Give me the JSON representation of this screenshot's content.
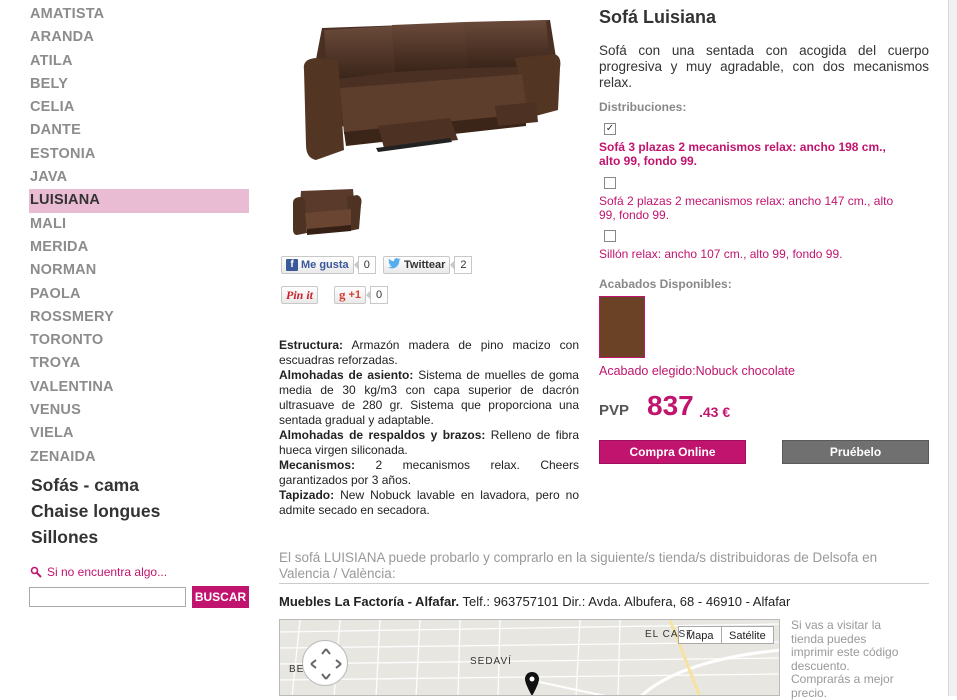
{
  "sidebar": {
    "models": [
      "AMATISTA",
      "ARANDA",
      "ATILA",
      "BELY",
      "CELIA",
      "DANTE",
      "ESTONIA",
      "JAVA",
      "LUISIANA",
      "MALI",
      "MERIDA",
      "NORMAN",
      "PAOLA",
      "ROSSMERY",
      "TORONTO",
      "TROYA",
      "VALENTINA",
      "VENUS",
      "VIELA",
      "ZENAIDA"
    ],
    "active_model": "LUISIANA",
    "categories": [
      "Sofás - cama",
      "Chaise longues",
      "Sillones"
    ],
    "search_hint": "Si no encuentra algo...",
    "search_value": "",
    "search_button": "BUSCAR"
  },
  "social": {
    "like_label": "Me gusta",
    "like_count": "0",
    "twitter_label": "Twittear",
    "twitter_count": "2",
    "pinit_label": "Pin it",
    "gplus_label": "+1",
    "gplus_count": "0"
  },
  "description": [
    {
      "label": "Estructura:",
      "text": " Armazón madera de pino macizo con escuadras reforzadas."
    },
    {
      "label": "Almohadas de asiento:",
      "text": " Sistema de muelles de goma media de 30 kg/m3 con capa superior de dacrón ultrasuave de 280 gr. Sistema que proporciona una sentada gradual y adaptable."
    },
    {
      "label": "Almohadas de respaldos y brazos:",
      "text": " Relleno de fibra hueca virgen siliconada."
    },
    {
      "label": "Mecanismos:",
      "text": " 2 mecanismos relax. Cheers garantizados por 3 años."
    },
    {
      "label": "Tapizado:",
      "text": " New Nobuck lavable en lavadora, pero no admite secado en secadora."
    }
  ],
  "product": {
    "title": "Sofá Luisiana",
    "intro": "Sofá con una sentada con acogida del cuerpo progresiva y muy agradable, con dos mecanismos relax.",
    "distribuciones_label": "Distribuciones:",
    "options": [
      {
        "text": "Sofá 3 plazas 2 mecanismos relax: ancho 198 cm., alto 99, fondo 99.",
        "checked": true
      },
      {
        "text": "Sofá 2 plazas 2 mecanismos relax: ancho 147 cm., alto 99, fondo 99.",
        "checked": false
      },
      {
        "text": "Sillón relax: ancho 107 cm., alto 99, fondo 99.",
        "checked": false
      }
    ],
    "acabados_label": "Acabados Disponibles:",
    "swatch_color": "#6b4226",
    "acabado_elegido": "Acabado elegido:Nobuck chocolate",
    "pvp_label": "PVP",
    "price_int": "837",
    "price_dec": ".43 €",
    "buy_button": "Compra Online",
    "try_button": "Pruébelo",
    "accent_color": "#c0146e"
  },
  "store": {
    "intro": "El sofá LUISIANA puede probarlo y comprarlo en la siguiente/s tienda/s distribuidoras de Delsofa en Valencia / València:",
    "name": "Muebles La Factoría - Alfafar.",
    "details": " Telf.: 963757101 Dir.: Avda. Albufera, 68 - 46910 - Alfafar",
    "map_button_map": "Mapa",
    "map_button_sat": "Satélite",
    "map_labels": [
      "EL CAST",
      "SEDAVÍ",
      "BE"
    ],
    "side_note": "Si vas a visitar la tienda puedes imprimir este código descuento. Comprarás a mejor precio."
  }
}
